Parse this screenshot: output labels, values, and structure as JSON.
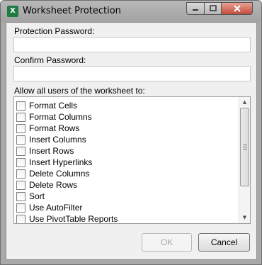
{
  "window": {
    "title": "Worksheet Protection",
    "app_icon_letter": "X"
  },
  "form": {
    "password_label": "Protection Password:",
    "password_value": "",
    "confirm_label": "Confirm Password:",
    "confirm_value": "",
    "allow_label": "Allow all users of the worksheet to:"
  },
  "permissions": {
    "items": [
      {
        "label": "Format Cells",
        "checked": false
      },
      {
        "label": "Format Columns",
        "checked": false
      },
      {
        "label": "Format Rows",
        "checked": false
      },
      {
        "label": "Insert Columns",
        "checked": false
      },
      {
        "label": "Insert Rows",
        "checked": false
      },
      {
        "label": "Insert Hyperlinks",
        "checked": false
      },
      {
        "label": "Delete Columns",
        "checked": false
      },
      {
        "label": "Delete Rows",
        "checked": false
      },
      {
        "label": "Sort",
        "checked": false
      },
      {
        "label": "Use AutoFilter",
        "checked": false
      },
      {
        "label": "Use PivotTable Reports",
        "checked": false
      }
    ]
  },
  "buttons": {
    "ok_label": "OK",
    "ok_enabled": false,
    "cancel_label": "Cancel"
  },
  "icons": {
    "app": "excel-icon",
    "minimize": "minimize-icon",
    "maximize": "maximize-icon",
    "close": "close-icon",
    "scroll_up": "scroll-up-icon",
    "scroll_down": "scroll-down-icon"
  },
  "colors": {
    "title_bar": "#a9a9a9",
    "close_button": "#c44b3a",
    "excel_green": "#1f7a43",
    "dialog_bg": "#f0f0f0"
  }
}
